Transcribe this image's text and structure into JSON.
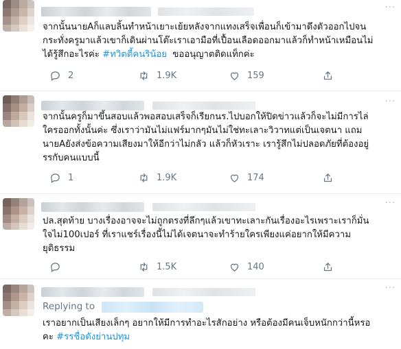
{
  "tweets": [
    {
      "text_plain": "จากนั้นนายAก็แลบลิ้นทำหน้าเยาะเย้ยหลังจากแทงเสร็จเพื่อนก็เข้ามาดึงตัวออกไปจน\nกระทั่งครูมาแล้วเขาก็เดินผ่านโต๊ะเราเอามือที่เปื้อนเลือดออกมาแล้วก็ทำหน้าเหมือนไม่\nได้รู้สึกอะไรค่ะ ",
      "hashtag": "#ทวิตตี้คนริน้อย",
      "text_after": "  ขออนุญาตติดแท็กค่ะ",
      "replies": "2",
      "retweets": "1.9K",
      "likes": "159"
    },
    {
      "text_plain": "จากนั้นครูก็มาขึ้นสอบแล้วพอสอบเสร็จก็เรียกนร.ไปบอกให้ปิดข่าวแล้วก็จะไม่มีการไล่\nใครออกทั้งนั้นค่ะ ซึ่งเราว่ามันไม่แฟร์มากๆมันไม่ใช่ทะเลาะวิวาทแต่เป็นเจตนา แถม\nนายAยังส่งข้อความเสียงมาให้อีกว่าไม่กลัว แล้วก็หัวเราะ เรารู้สึกไม่ปลอดภัยที่ต้องอยู่\nรรกับคนแบบนี้",
      "hashtag": "",
      "text_after": "",
      "replies": "1",
      "retweets": "1.9K",
      "likes": "174"
    },
    {
      "text_plain": "ปล.สุดท้าย บางเรื่องอาจจะไม่ถูกตรงที่ลึกๆแล้วเขาทะเลาะกันเรื่องอะไรเพราะเราก็มั่น\nใจไม่100เปอร์ ที่เราแชร์เรื่องนี้ไม่ได้เจตนาจะทำร้ายใครเพียงแค่อยากให้มีความ\nยุติธรรม",
      "hashtag": "",
      "text_after": "",
      "replies": "",
      "retweets": "1.5K",
      "likes": "140"
    },
    {
      "replying_to": "Replying to",
      "text_plain": "เราอยากเป็นเสียงเล็กๆ อยากให้มีการทำอะไรสักอย่าง หรือต้องมีคนเจ็บหนักกว่านี้หรอ\nคะ ",
      "hashtag": "#รรชื่อดังย่านปทุม",
      "text_after": ""
    }
  ],
  "icons": {
    "reply": "reply-icon",
    "retweet": "retweet-icon",
    "like": "heart-icon",
    "share": "share-icon",
    "more": "more-dots-icon"
  },
  "colors": {
    "hashtag": "#1b95e0",
    "meta": "#657786",
    "text": "#14171a",
    "divider": "#e6ecf0"
  }
}
